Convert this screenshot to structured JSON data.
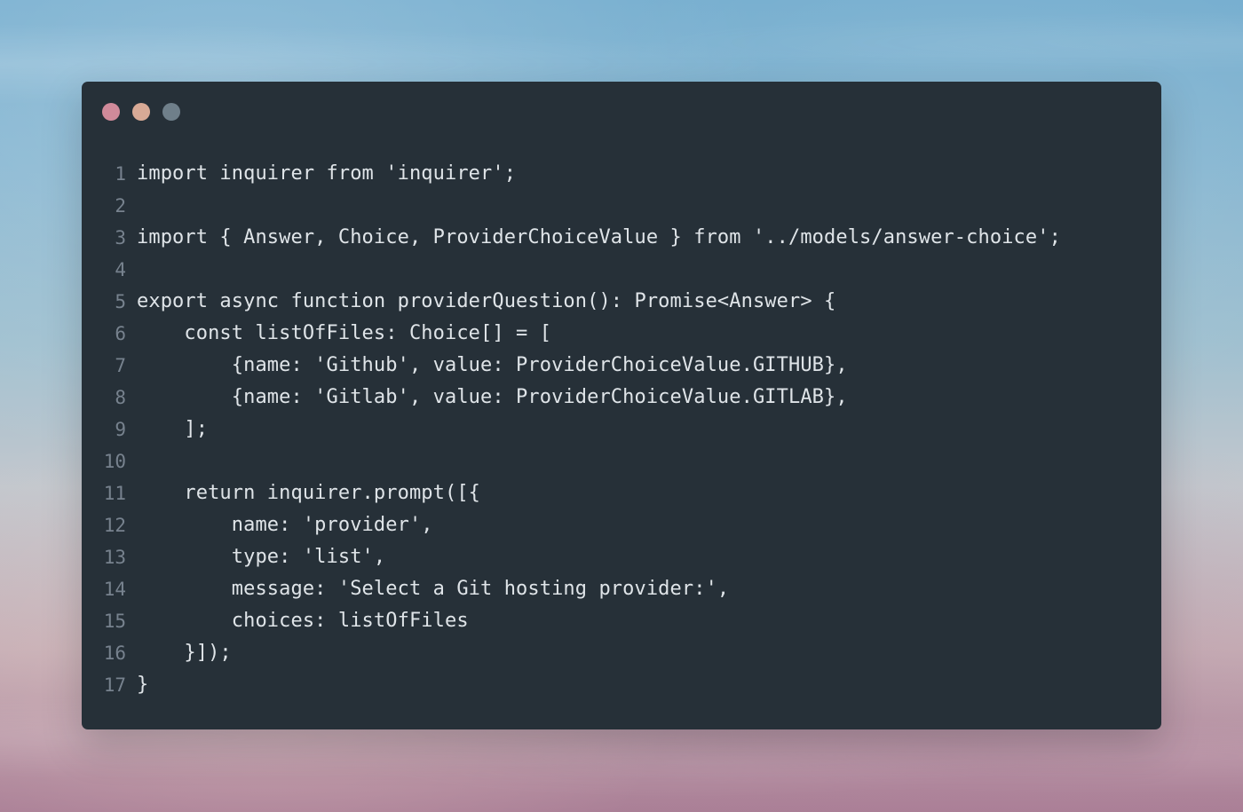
{
  "window": {
    "background_color": "#263038",
    "controls": {
      "close_color": "#d08a9a",
      "minimize_color": "#d8aa96",
      "maximize_color": "#6f7f8a"
    }
  },
  "code": {
    "lines": [
      {
        "number": "1",
        "text": "import inquirer from 'inquirer';"
      },
      {
        "number": "2",
        "text": ""
      },
      {
        "number": "3",
        "text": "import { Answer, Choice, ProviderChoiceValue } from '../models/answer-choice';"
      },
      {
        "number": "4",
        "text": ""
      },
      {
        "number": "5",
        "text": "export async function providerQuestion(): Promise<Answer> {"
      },
      {
        "number": "6",
        "text": "    const listOfFiles: Choice[] = ["
      },
      {
        "number": "7",
        "text": "        {name: 'Github', value: ProviderChoiceValue.GITHUB},"
      },
      {
        "number": "8",
        "text": "        {name: 'Gitlab', value: ProviderChoiceValue.GITLAB},"
      },
      {
        "number": "9",
        "text": "    ];"
      },
      {
        "number": "10",
        "text": ""
      },
      {
        "number": "11",
        "text": "    return inquirer.prompt([{"
      },
      {
        "number": "12",
        "text": "        name: 'provider',"
      },
      {
        "number": "13",
        "text": "        type: 'list',"
      },
      {
        "number": "14",
        "text": "        message: 'Select a Git hosting provider:',"
      },
      {
        "number": "15",
        "text": "        choices: listOfFiles"
      },
      {
        "number": "16",
        "text": "    }]);"
      },
      {
        "number": "17",
        "text": "}"
      }
    ]
  }
}
